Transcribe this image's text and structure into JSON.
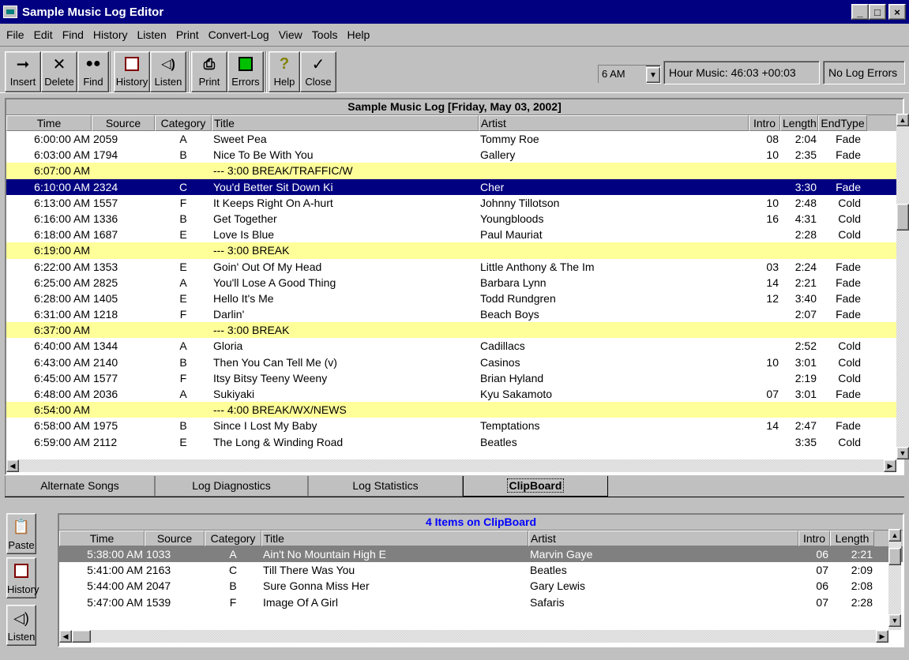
{
  "window": {
    "title": "Sample Music Log Editor",
    "min": "_",
    "max": "□",
    "close": "×"
  },
  "menu": [
    "File",
    "Edit",
    "Find",
    "History",
    "Listen",
    "Print",
    "Convert-Log",
    "View",
    "Tools",
    "Help"
  ],
  "toolbar": {
    "insert": "Insert",
    "delete": "Delete",
    "find": "Find",
    "history": "History",
    "listen": "Listen",
    "print": "Print",
    "errors": "Errors",
    "help": "Help",
    "close": "Close"
  },
  "hour_select": {
    "value": "6 AM"
  },
  "status": {
    "hour_music": "Hour Music: 46:03 +00:03",
    "log_errors": "No Log Errors"
  },
  "log": {
    "caption": "Sample Music Log   [Friday, May 03, 2002]",
    "columns": [
      "Time",
      "Source",
      "Category",
      "Title",
      "Artist",
      "Intro",
      "Length",
      "EndType"
    ],
    "rows": [
      {
        "time": "6:00:00 AM",
        "source": "2059",
        "cat": "A",
        "title": "Sweet Pea",
        "artist": "Tommy Roe",
        "intro": "08",
        "len": "2:04",
        "end": "Fade",
        "kind": "song"
      },
      {
        "time": "6:03:00 AM",
        "source": "1794",
        "cat": "B",
        "title": "Nice To Be With You",
        "artist": "Gallery",
        "intro": "10",
        "len": "2:35",
        "end": "Fade",
        "kind": "song"
      },
      {
        "time": "6:07:00 AM",
        "source": "",
        "cat": "",
        "title": "--- 3:00 BREAK/TRAFFIC/W",
        "artist": "",
        "intro": "",
        "len": "",
        "end": "",
        "kind": "break"
      },
      {
        "time": "6:10:00 AM",
        "source": "2324",
        "cat": "C",
        "title": "You'd Better Sit Down Ki",
        "artist": "Cher",
        "intro": "",
        "len": "3:30",
        "end": "Fade",
        "kind": "selected"
      },
      {
        "time": "6:13:00 AM",
        "source": "1557",
        "cat": "F",
        "title": "It Keeps Right On A-hurt",
        "artist": "Johnny Tillotson",
        "intro": "10",
        "len": "2:48",
        "end": "Cold",
        "kind": "song"
      },
      {
        "time": "6:16:00 AM",
        "source": "1336",
        "cat": "B",
        "title": "Get Together",
        "artist": "Youngbloods",
        "intro": "16",
        "len": "4:31",
        "end": "Cold",
        "kind": "song"
      },
      {
        "time": "6:18:00 AM",
        "source": "1687",
        "cat": "E",
        "title": "Love Is Blue",
        "artist": "Paul Mauriat",
        "intro": "",
        "len": "2:28",
        "end": "Cold",
        "kind": "song"
      },
      {
        "time": "6:19:00 AM",
        "source": "",
        "cat": "",
        "title": "--- 3:00 BREAK",
        "artist": "",
        "intro": "",
        "len": "",
        "end": "",
        "kind": "break"
      },
      {
        "time": "6:22:00 AM",
        "source": "1353",
        "cat": "E",
        "title": "Goin' Out Of My Head",
        "artist": "Little Anthony & The Im",
        "intro": "03",
        "len": "2:24",
        "end": "Fade",
        "kind": "song"
      },
      {
        "time": "6:25:00 AM",
        "source": "2825",
        "cat": "A",
        "title": "You'll Lose A Good Thing",
        "artist": "Barbara Lynn",
        "intro": "14",
        "len": "2:21",
        "end": "Fade",
        "kind": "song"
      },
      {
        "time": "6:28:00 AM",
        "source": "1405",
        "cat": "E",
        "title": "Hello It's Me",
        "artist": "Todd Rundgren",
        "intro": "12",
        "len": "3:40",
        "end": "Fade",
        "kind": "song"
      },
      {
        "time": "6:31:00 AM",
        "source": "1218",
        "cat": "F",
        "title": "Darlin'",
        "artist": "Beach Boys",
        "intro": "",
        "len": "2:07",
        "end": "Fade",
        "kind": "song"
      },
      {
        "time": "6:37:00 AM",
        "source": "",
        "cat": "",
        "title": "--- 3:00 BREAK",
        "artist": "",
        "intro": "",
        "len": "",
        "end": "",
        "kind": "break"
      },
      {
        "time": "6:40:00 AM",
        "source": "1344",
        "cat": "A",
        "title": "Gloria",
        "artist": "Cadillacs",
        "intro": "",
        "len": "2:52",
        "end": "Cold",
        "kind": "song"
      },
      {
        "time": "6:43:00 AM",
        "source": "2140",
        "cat": "B",
        "title": "Then You Can Tell Me (v)",
        "artist": "Casinos",
        "intro": "10",
        "len": "3:01",
        "end": "Cold",
        "kind": "song"
      },
      {
        "time": "6:45:00 AM",
        "source": "1577",
        "cat": "F",
        "title": "Itsy Bitsy Teeny Weeny",
        "artist": "Brian Hyland",
        "intro": "",
        "len": "2:19",
        "end": "Cold",
        "kind": "song"
      },
      {
        "time": "6:48:00 AM",
        "source": "2036",
        "cat": "A",
        "title": "Sukiyaki",
        "artist": "Kyu Sakamoto",
        "intro": "07",
        "len": "3:01",
        "end": "Fade",
        "kind": "song"
      },
      {
        "time": "6:54:00 AM",
        "source": "",
        "cat": "",
        "title": "--- 4:00 BREAK/WX/NEWS",
        "artist": "",
        "intro": "",
        "len": "",
        "end": "",
        "kind": "break"
      },
      {
        "time": "6:58:00 AM",
        "source": "1975",
        "cat": "B",
        "title": "Since I Lost My Baby",
        "artist": "Temptations",
        "intro": "14",
        "len": "2:47",
        "end": "Fade",
        "kind": "song"
      },
      {
        "time": "6:59:00 AM",
        "source": "2112",
        "cat": "E",
        "title": "The Long & Winding Road",
        "artist": "Beatles",
        "intro": "",
        "len": "3:35",
        "end": "Cold",
        "kind": "song"
      }
    ]
  },
  "tabs": [
    "Alternate Songs",
    "Log Diagnostics",
    "Log Statistics",
    "ClipBoard"
  ],
  "active_tab": "ClipBoard",
  "side_buttons": {
    "paste": "Paste",
    "history": "History",
    "listen": "Listen"
  },
  "clipboard": {
    "caption": "4 Items on ClipBoard",
    "columns": [
      "Time",
      "Source",
      "Category",
      "Title",
      "Artist",
      "Intro",
      "Length"
    ],
    "rows": [
      {
        "time": "5:38:00 AM",
        "source": "1033",
        "cat": "A",
        "title": "Ain't No Mountain High E",
        "artist": "Marvin Gaye",
        "intro": "06",
        "len": "2:21",
        "kind": "csel"
      },
      {
        "time": "5:41:00 AM",
        "source": "2163",
        "cat": "C",
        "title": "Till There Was You",
        "artist": "Beatles",
        "intro": "07",
        "len": "2:09",
        "kind": "song"
      },
      {
        "time": "5:44:00 AM",
        "source": "2047",
        "cat": "B",
        "title": "Sure Gonna Miss Her",
        "artist": "Gary Lewis",
        "intro": "06",
        "len": "2:08",
        "kind": "song"
      },
      {
        "time": "5:47:00 AM",
        "source": "1539",
        "cat": "F",
        "title": "Image Of A Girl",
        "artist": "Safaris",
        "intro": "07",
        "len": "2:28",
        "kind": "song"
      }
    ]
  }
}
